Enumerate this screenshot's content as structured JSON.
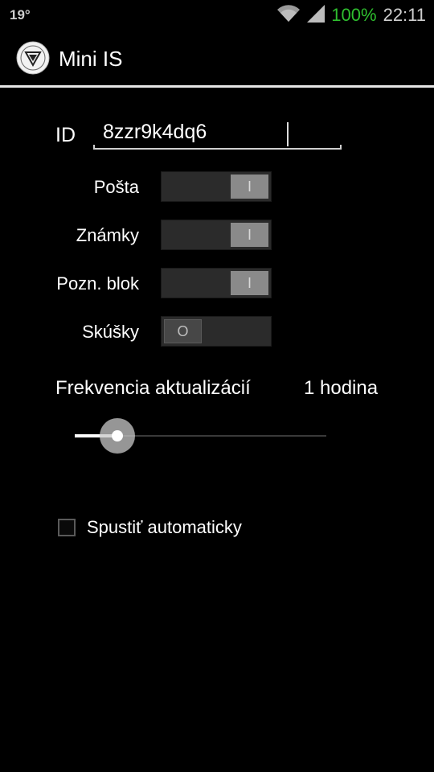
{
  "status_bar": {
    "temperature": "19°",
    "battery": "100%",
    "time": "22:11",
    "icons": [
      "wifi-icon",
      "signal-icon"
    ],
    "battery_color": "#2fbf2f"
  },
  "action_bar": {
    "title": "Mini IS",
    "logo_icon": "app-logo-icon"
  },
  "form": {
    "id_label": "ID",
    "id_value": "8zzr9k4dq6",
    "toggles": [
      {
        "label": "Pošta",
        "state": "I",
        "on": true
      },
      {
        "label": "Známky",
        "state": "I",
        "on": true
      },
      {
        "label": "Pozn. blok",
        "state": "I",
        "on": true
      },
      {
        "label": "Skúšky",
        "state": "O",
        "on": false
      }
    ],
    "frequency_label": "Frekvencia aktualizácií",
    "frequency_value": "1 hodina",
    "frequency_slider_fraction": 0.17,
    "autostart_label": "Spustiť automaticky",
    "autostart_checked": false
  }
}
